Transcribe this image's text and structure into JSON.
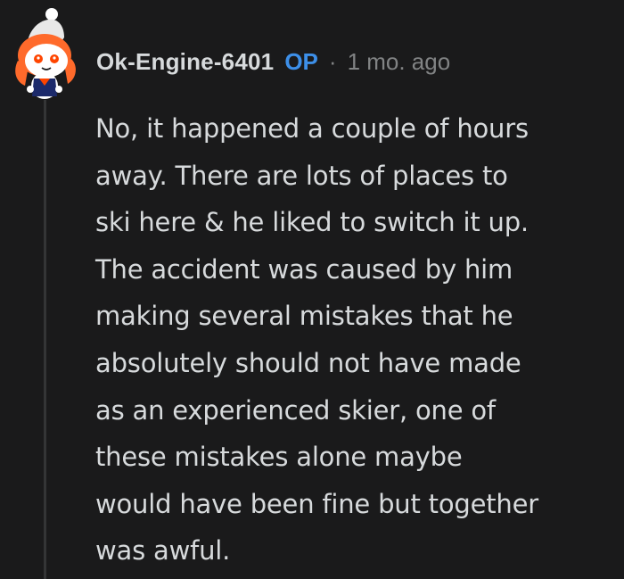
{
  "comment": {
    "author": "Ok-Engine-6401",
    "op_badge": "OP",
    "separator": "·",
    "timestamp": "1 mo. ago",
    "avatar_icon": "snoo-avatar-icon",
    "body_lines": [
      "No, it happened a couple of hours",
      "away. There are lots of places to",
      "ski here & he liked to switch it up.",
      "The accident was caused by him",
      "making several mistakes that he",
      "absolutely should not have made",
      "as an experienced skier, one of",
      "these mistakes alone maybe",
      "would have been fine but together",
      "was awful."
    ],
    "colors": {
      "background": "#1a1a1b",
      "text": "#d7dadc",
      "op": "#3d8fe8",
      "muted": "#818384",
      "thread_line": "#343536"
    }
  }
}
